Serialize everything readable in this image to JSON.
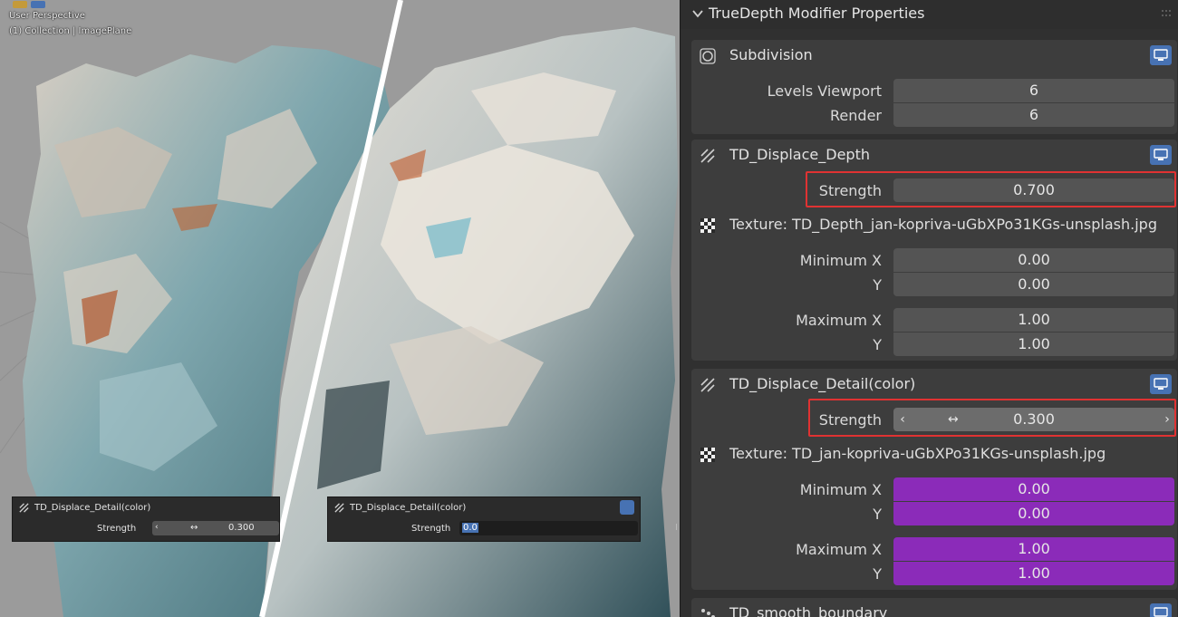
{
  "viewport": {
    "view_label": "User Perspective",
    "collection_label": "(1) Collection | ImagePlane",
    "redo_panels": [
      {
        "title": "TD_Displace_Detail(color)",
        "label": "Strength",
        "value": "0.300"
      },
      {
        "title": "TD_Displace_Detail(color)",
        "label": "Strength",
        "value": "0.0"
      }
    ]
  },
  "panel": {
    "title": "TrueDepth Modifier Properties",
    "modifiers": [
      {
        "name": "Subdivision",
        "icon": "subdivision-circle-icon",
        "levels_viewport_label": "Levels Viewport",
        "levels_viewport": "6",
        "render_label": "Render",
        "render": "6"
      },
      {
        "name": "TD_Displace_Depth",
        "icon": "displace-icon",
        "strength_label": "Strength",
        "strength": "0.700",
        "texture": "Texture: TD_Depth_jan-kopriva-uGbXPo31KGs-unsplash.jpg",
        "min_x_label": "Minimum X",
        "min_x": "0.00",
        "min_y_label": "Y",
        "min_y": "0.00",
        "max_x_label": "Maximum X",
        "max_x": "1.00",
        "max_y_label": "Y",
        "max_y": "1.00"
      },
      {
        "name": "TD_Displace_Detail(color)",
        "icon": "displace-icon",
        "strength_label": "Strength",
        "strength": "0.300",
        "texture": "Texture: TD_jan-kopriva-uGbXPo31KGs-unsplash.jpg",
        "min_x_label": "Minimum X",
        "min_x": "0.00",
        "min_y_label": "Y",
        "min_y": "0.00",
        "max_x_label": "Maximum X",
        "max_x": "1.00",
        "max_y_label": "Y",
        "max_y": "1.00"
      },
      {
        "name": "TD_smooth_boundary",
        "icon": "smooth-icon"
      }
    ]
  },
  "colors": {
    "accent_blue": "#4772b3",
    "highlight_red": "#e03232",
    "purple_field": "#8b2bb9",
    "panel_bg": "#303030",
    "field_bg": "#545454"
  }
}
